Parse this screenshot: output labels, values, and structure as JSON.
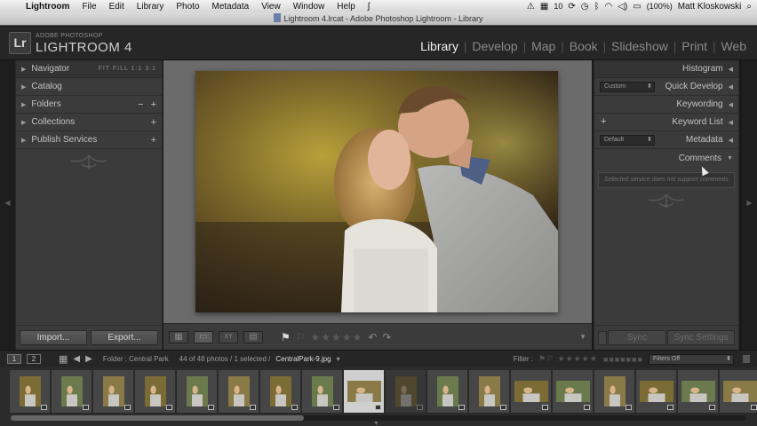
{
  "menubar": {
    "app_name": "Lightroom",
    "items": [
      "File",
      "Edit",
      "Library",
      "Photo",
      "Metadata",
      "View",
      "Window",
      "Help"
    ],
    "battery": "(100%)",
    "user": "Matt Kloskowski",
    "badge_count": "10"
  },
  "window_title": "Lightroom 4.lrcat - Adobe Photoshop Lightroom - Library",
  "identity": {
    "badge": "Lr",
    "small": "ADOBE PHOTOSHOP",
    "big": "LIGHTROOM 4"
  },
  "modules": [
    "Library",
    "Develop",
    "Map",
    "Book",
    "Slideshow",
    "Print",
    "Web"
  ],
  "left_panel": {
    "navigator": {
      "label": "Navigator",
      "options": "FIT  FILL  1:1  3:1"
    },
    "catalog": "Catalog",
    "folders": "Folders",
    "collections": "Collections",
    "publish": "Publish Services",
    "import_label": "Import...",
    "export_label": "Export..."
  },
  "right_panel": {
    "histogram": "Histogram",
    "quick_develop": "Quick Develop",
    "quick_develop_preset": "Custom",
    "keywording": "Keywording",
    "keyword_list": "Keyword List",
    "metadata": "Metadata",
    "metadata_preset": "Default",
    "comments": "Comments",
    "comments_message": "Selected service does not support comments",
    "sync_label": "Sync",
    "sync_settings_label": "Sync Settings"
  },
  "filmbar": {
    "monitor_1": "1",
    "monitor_2": "2",
    "folder": "Folder : Central Park",
    "count": "44 of 48 photos / 1 selected /",
    "filename": "CentralPark-9.jpg",
    "filter_label": "Filter :",
    "filter_value": "Filters Off"
  },
  "filmstrip": {
    "frames": [
      {
        "orientation": "portrait",
        "state": "normal"
      },
      {
        "orientation": "portrait",
        "state": "normal"
      },
      {
        "orientation": "portrait",
        "state": "normal"
      },
      {
        "orientation": "portrait",
        "state": "normal"
      },
      {
        "orientation": "portrait",
        "state": "normal"
      },
      {
        "orientation": "portrait",
        "state": "normal"
      },
      {
        "orientation": "portrait",
        "state": "normal"
      },
      {
        "orientation": "portrait",
        "state": "normal"
      },
      {
        "orientation": "landscape",
        "state": "selected"
      },
      {
        "orientation": "portrait",
        "state": "dim"
      },
      {
        "orientation": "portrait",
        "state": "normal"
      },
      {
        "orientation": "portrait",
        "state": "normal"
      },
      {
        "orientation": "landscape",
        "state": "normal"
      },
      {
        "orientation": "landscape",
        "state": "normal"
      },
      {
        "orientation": "portrait",
        "state": "normal"
      },
      {
        "orientation": "landscape",
        "state": "normal"
      },
      {
        "orientation": "landscape",
        "state": "normal"
      },
      {
        "orientation": "landscape",
        "state": "normal"
      }
    ]
  },
  "colors": {
    "panel": "#3b3b3b",
    "background": "#1a1a1a",
    "active_module": "#f0f0f0"
  }
}
